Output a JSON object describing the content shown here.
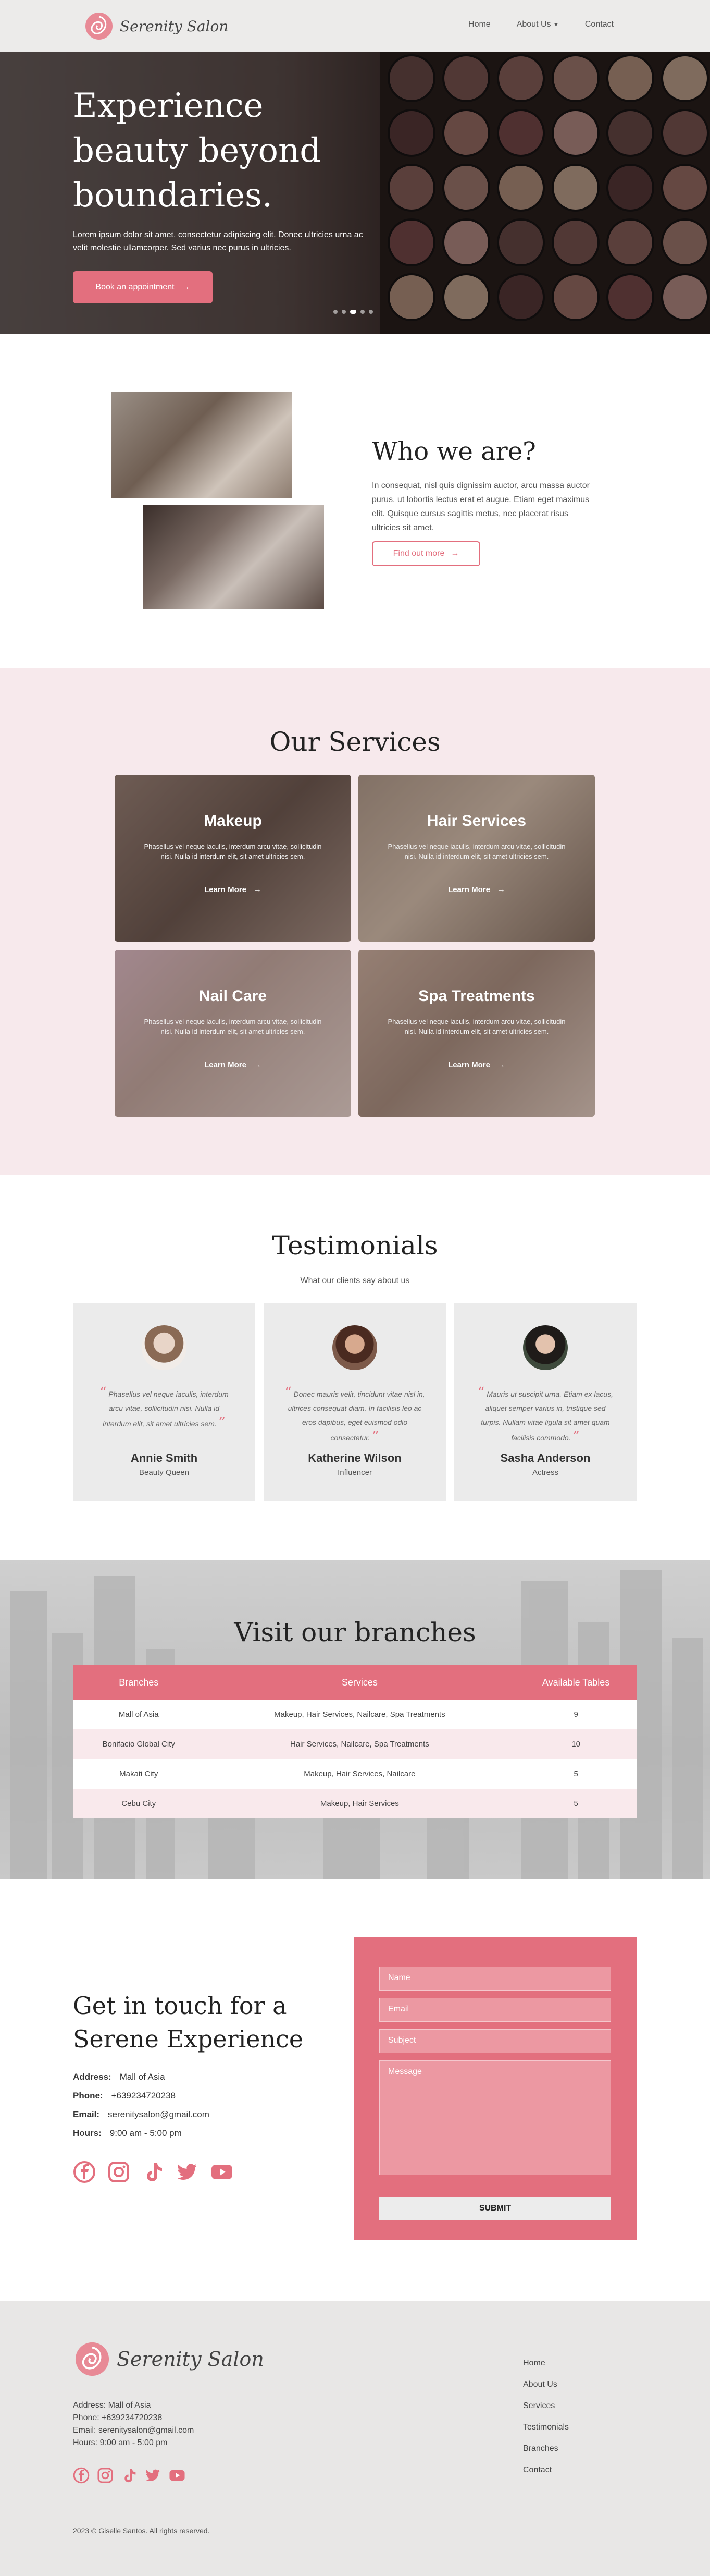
{
  "nav": {
    "brand": "Serenity Salon",
    "links": [
      "Home",
      "About Us",
      "Contact"
    ]
  },
  "hero": {
    "title": "Experience beauty beyond boundaries.",
    "text": "Lorem ipsum dolor sit amet, consectetur adipiscing elit. Donec ultricies urna ac velit molestie ullamcorper. Sed varius nec purus in ultricies.",
    "button": "Book an appointment",
    "slide_count": 5,
    "active_slide": 2
  },
  "about": {
    "title": "Who we are?",
    "text": "In consequat, nisl quis dignissim auctor, arcu massa auctor purus, ut lobortis lectus erat et augue. Etiam eget maximus elit. Quisque cursus sagittis metus, nec placerat risus ultricies sit amet.",
    "button": "Find out more"
  },
  "services": {
    "title": "Our Services",
    "cards": [
      {
        "title": "Makeup",
        "text": "Phasellus vel neque iaculis, interdum arcu vitae, sollicitudin nisi. Nulla id interdum elit, sit amet ultricies sem.",
        "link": "Learn More"
      },
      {
        "title": "Hair Services",
        "text": "Phasellus vel neque iaculis, interdum arcu vitae, sollicitudin nisi. Nulla id interdum elit, sit amet ultricies sem.",
        "link": "Learn More"
      },
      {
        "title": "Nail Care",
        "text": "Phasellus vel neque iaculis, interdum arcu vitae, sollicitudin nisi. Nulla id interdum elit, sit amet ultricies sem.",
        "link": "Learn More"
      },
      {
        "title": "Spa Treatments",
        "text": "Phasellus vel neque iaculis, interdum arcu vitae, sollicitudin nisi. Nulla id interdum elit, sit amet ultricies sem.",
        "link": "Learn More"
      }
    ]
  },
  "testimonials": {
    "title": "Testimonials",
    "subtitle": "What our clients say about us",
    "items": [
      {
        "quote": "Phasellus vel neque iaculis, interdum arcu vitae, sollicitudin nisi. Nulla id interdum elit, sit amet ultricies sem.",
        "name": "Annie Smith",
        "role": "Beauty Queen"
      },
      {
        "quote": "Donec mauris velit, tincidunt vitae nisl in, ultrices consequat diam. In facilisis leo ac eros dapibus, eget euismod odio consectetur.",
        "name": "Katherine Wilson",
        "role": "Influencer"
      },
      {
        "quote": "Mauris ut suscipit urna. Etiam ex lacus, aliquet semper varius in, tristique sed turpis. Nullam vitae ligula sit amet quam facilisis commodo.",
        "name": "Sasha Anderson",
        "role": "Actress"
      }
    ]
  },
  "branches": {
    "title": "Visit our branches",
    "headers": [
      "Branches",
      "Services",
      "Available Tables"
    ],
    "rows": [
      [
        "Mall of Asia",
        "Makeup, Hair Services, Nailcare, Spa Treatments",
        "9"
      ],
      [
        "Bonifacio Global City",
        "Hair Services, Nailcare, Spa Treatments",
        "10"
      ],
      [
        "Makati City",
        "Makeup, Hair Services, Nailcare",
        "5"
      ],
      [
        "Cebu City",
        "Makeup, Hair Services",
        "5"
      ]
    ]
  },
  "contact": {
    "title": "Get in touch for a Serene Experience",
    "rows": [
      {
        "label": "Address:",
        "value": "Mall of Asia"
      },
      {
        "label": "Phone:",
        "value": "+639234720238"
      },
      {
        "label": "Email:",
        "value": "serenitysalon@gmail.com"
      },
      {
        "label": "Hours:",
        "value": "9:00 am - 5:00 pm"
      }
    ],
    "socials": [
      "facebook-icon",
      "instagram-icon",
      "tiktok-icon",
      "twitter-icon",
      "youtube-icon"
    ],
    "form": {
      "name_placeholder": "Name",
      "email_placeholder": "Email",
      "subject_placeholder": "Subject",
      "message_placeholder": "Message",
      "submit": "SUBMIT"
    }
  },
  "footer": {
    "brand": "Serenity Salon",
    "info": [
      "Address: Mall of Asia",
      "Phone: +639234720238",
      "Email: serenitysalon@gmail.com",
      "Hours: 9:00 am - 5:00 pm"
    ],
    "links": [
      "Home",
      "About Us",
      "Services",
      "Testimonials",
      "Branches",
      "Contact"
    ],
    "copyright": "2023 © Giselle Santos. All rights reserved."
  },
  "colors": {
    "accent": "#e36f7e",
    "accent_light": "#f7e9ec",
    "footer_bg": "#e8e7e6"
  }
}
